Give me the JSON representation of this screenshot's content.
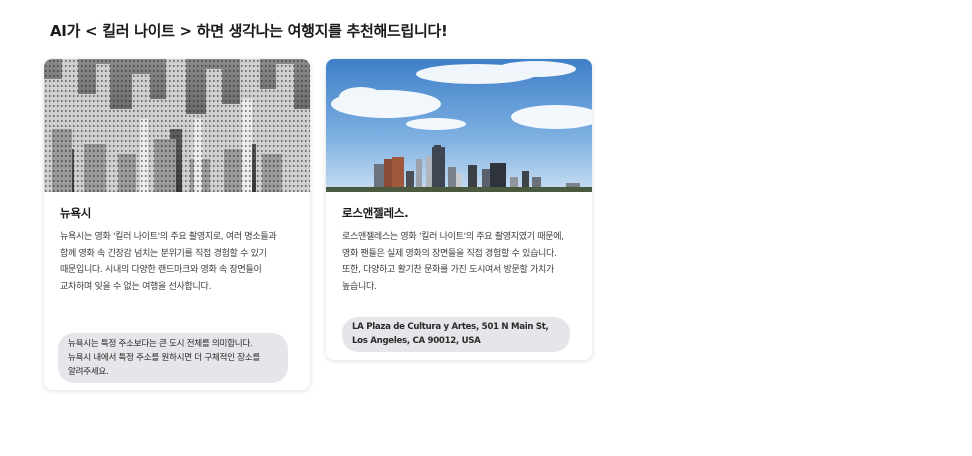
{
  "heading": "AI가 < 킬러 나이트 > 하면 생각나는 여행지를 추천해드립니다!",
  "cards": [
    {
      "image": "new-york-skyline-photo",
      "title": "뉴욕시",
      "description": "뉴욕시는 영화 '킬러 나이트'의 주요 촬영지로, 여러 명소들과 함께 영화 속 긴장감 넘치는 분위기를 직접 경험할 수 있기 때문입니다. 시내의 다양한 랜드마크와 영화 속 장면들이 교차하며 잊을 수 없는 여행을 선사합니다.",
      "address": "뉴욕시는 특정 주소보다는 큰 도시 전체를 의미합니다.\n뉴욕시 내에서 특정 주소를 원하시면 더 구체적인 장소를\n알려주세요."
    },
    {
      "image": "los-angeles-skyline-photo",
      "title": "로스앤젤레스.",
      "description": "로스앤젤레스는 영화 '킬러 나이트'의 주요 촬영지였기 때문에, 영화 팬들은 실제 영화의 장면들을 직접 경험할 수 있습니다. 또한, 다양하고 활기찬 문화를 가진 도시여서 방문할 가치가 높습니다.",
      "address": "LA Plaza de Cultura y Artes, 501 N Main St,\nLos Angeles, CA 90012, USA"
    }
  ]
}
